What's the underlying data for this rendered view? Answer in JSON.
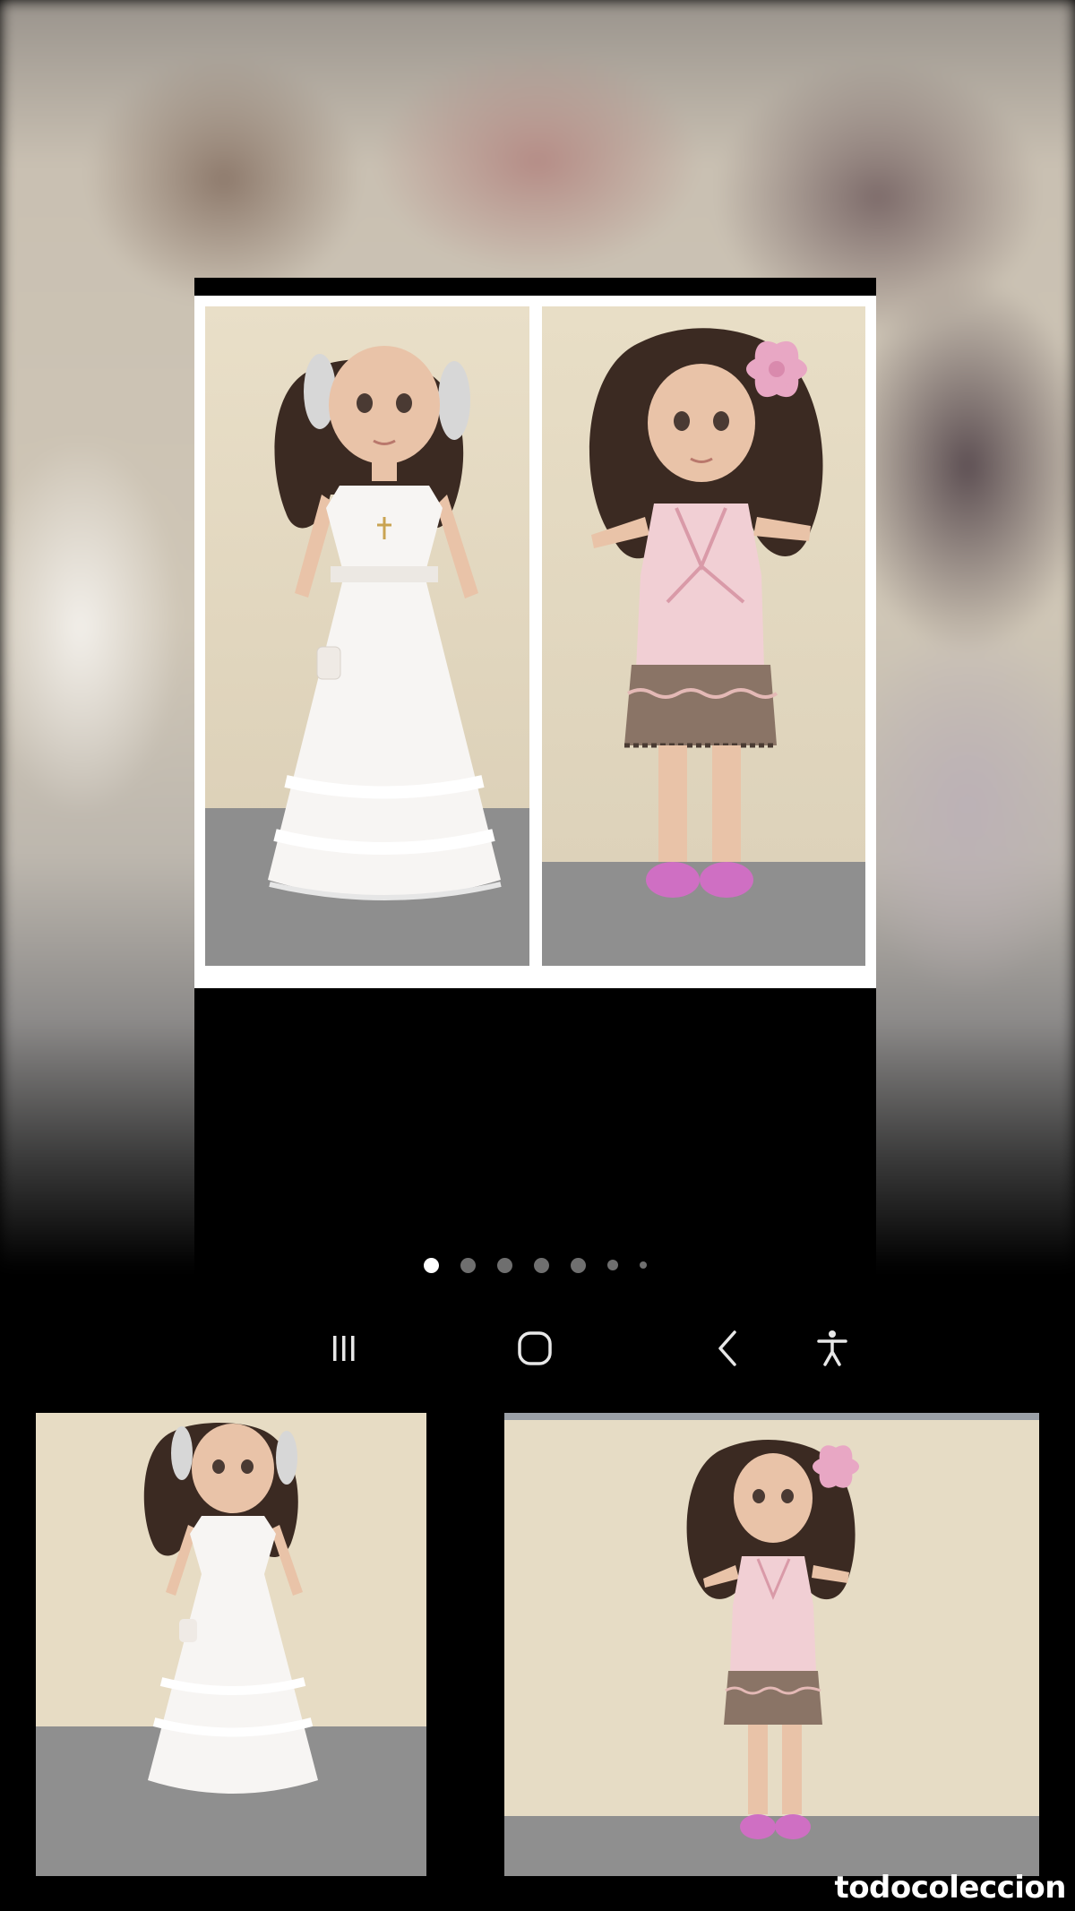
{
  "viewer": {
    "photos": [
      {
        "name": "doll-white-communion-dress"
      },
      {
        "name": "doll-pink-top-brown-skirt"
      }
    ],
    "page_indicator": {
      "total_dots": 7,
      "active_index": 0
    }
  },
  "navbar": {
    "buttons": [
      {
        "icon": "recent-apps-icon"
      },
      {
        "icon": "home-icon"
      },
      {
        "icon": "back-icon"
      },
      {
        "icon": "accessibility-icon"
      }
    ]
  },
  "thumbnails": [
    {
      "name": "doll-white-communion-dress-thumbnail"
    },
    {
      "name": "doll-pink-top-brown-skirt-thumbnail"
    }
  ],
  "watermark": {
    "text": "todocoleccion"
  },
  "colors": {
    "wall": "#e7dcc4",
    "floor": "#8f8f8f",
    "hair": "#3b2a22",
    "skin": "#e9c3a8",
    "dress_white": "#f7f5f3",
    "top_pink": "#f1cfd4",
    "skirt_brown": "#8a7466",
    "shoe_pink": "#cf6fc3",
    "flower_pink": "#e8a7c4",
    "dot_active": "#ffffff",
    "dot_inactive": "#6f6f6f"
  }
}
